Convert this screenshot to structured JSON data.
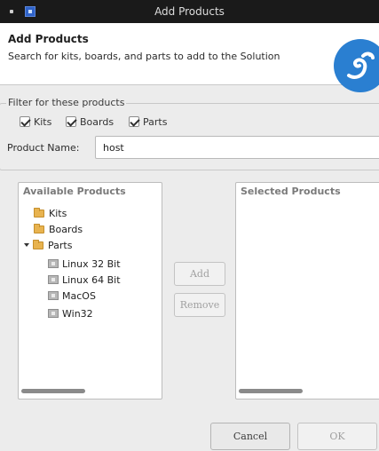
{
  "window": {
    "title": "Add Products"
  },
  "header": {
    "title": "Add Products",
    "subtitle": "Search for kits, boards, and parts to add to the Solution",
    "logo_icon": "lizard-logo-icon",
    "logo_color": "#2a7fd1"
  },
  "filter": {
    "legend": "Filter for these products",
    "kits_label": "Kits",
    "kits_checked": true,
    "boards_label": "Boards",
    "boards_checked": true,
    "parts_label": "Parts",
    "parts_checked": true,
    "product_name_label": "Product Name:",
    "product_name_value": "host"
  },
  "available": {
    "title": "Available Products",
    "items": [
      {
        "label": "Kits",
        "icon": "folder-icon"
      },
      {
        "label": "Boards",
        "icon": "folder-icon"
      },
      {
        "label": "Parts",
        "icon": "folder-icon",
        "expanded": true,
        "children": [
          {
            "label": "Linux 32 Bit",
            "icon": "part-icon"
          },
          {
            "label": "Linux 64 Bit",
            "icon": "part-icon"
          },
          {
            "label": "MacOS",
            "icon": "part-icon"
          },
          {
            "label": "Win32",
            "icon": "part-icon"
          }
        ]
      }
    ]
  },
  "selected": {
    "title": "Selected Products"
  },
  "actions": {
    "add_label": "Add",
    "remove_label": "Remove",
    "cancel_label": "Cancel",
    "ok_label": "OK"
  }
}
